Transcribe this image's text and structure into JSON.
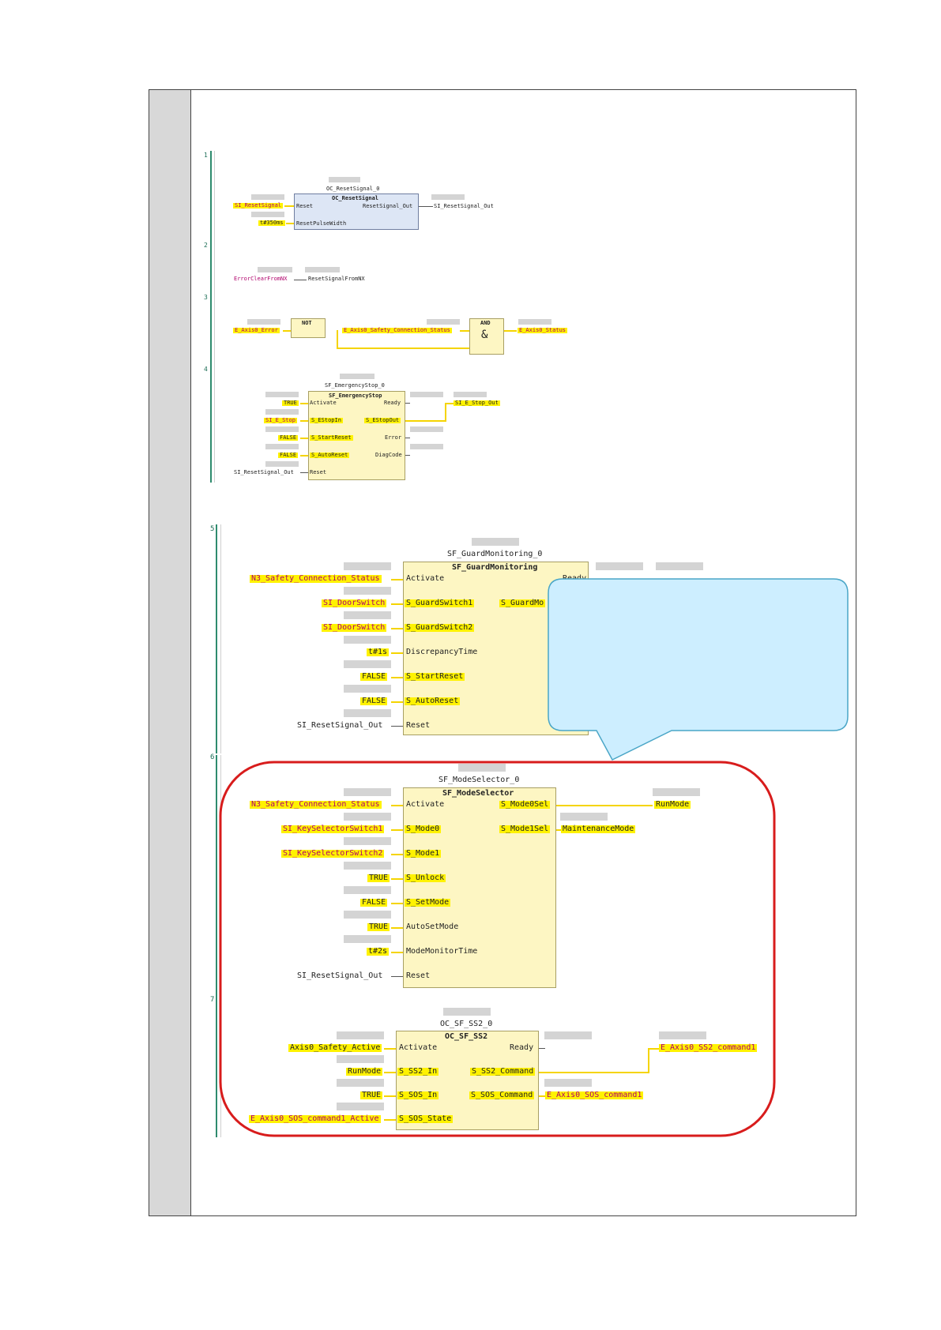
{
  "rung_numbers": [
    "1",
    "2",
    "3",
    "4",
    "5",
    "6",
    "7"
  ],
  "rung1": {
    "instance": "OC_ResetSignal_0",
    "type": "OC_ResetSignal",
    "in_reset_var": "SI_ResetSignal",
    "in_reset_pin": "Reset",
    "in_width_var": "t#350ms",
    "in_width_pin": "ResetPulseWidth",
    "out_pin": "ResetSignal_Out",
    "out_var": "SI_ResetSignal_Out"
  },
  "rung2": {
    "src": "ErrorClearFromNX",
    "dst": "ResetSignalFromNX"
  },
  "rung3": {
    "in_var": "E_Axis0_Error",
    "not_label": "NOT",
    "mid_var": "E_Axis0_Safety_Connection_Status",
    "and_label": "AND",
    "and_symbol": "&",
    "out_var": "E_Axis0_Status"
  },
  "rung4": {
    "instance": "SF_EmergencyStop_0",
    "type": "SF_EmergencyStop",
    "inputs": [
      {
        "var": "TRUE",
        "pin": "Activate"
      },
      {
        "var": "SI_E_Stop",
        "pin": "S_EStopIn"
      },
      {
        "var": "FALSE",
        "pin": "S_StartReset"
      },
      {
        "var": "FALSE",
        "pin": "S_AutoReset"
      },
      {
        "var": "SI_ResetSignal_Out",
        "pin": "Reset"
      }
    ],
    "outputs": [
      {
        "pin": "Ready",
        "var": ""
      },
      {
        "pin": "S_EStopOut",
        "var": "SI_E_Stop_Out"
      },
      {
        "pin": "Error",
        "var": ""
      },
      {
        "pin": "DiagCode",
        "var": ""
      }
    ]
  },
  "rung5": {
    "instance": "SF_GuardMonitoring_0",
    "type": "SF_GuardMonitoring",
    "inputs": [
      {
        "var": "N3_Safety_Connection_Status",
        "pin": "Activate"
      },
      {
        "var": "SI_DoorSwitch",
        "pin": "S_GuardSwitch1"
      },
      {
        "var": "SI_DoorSwitch",
        "pin": "S_GuardSwitch2"
      },
      {
        "var": "t#1s",
        "pin": "DiscrepancyTime"
      },
      {
        "var": "FALSE",
        "pin": "S_StartReset"
      },
      {
        "var": "FALSE",
        "pin": "S_AutoReset"
      },
      {
        "var": "SI_ResetSignal_Out",
        "pin": "Reset"
      }
    ],
    "partial_output_pin": "S_GuardMo",
    "partial_ready_pin": "Ready"
  },
  "rung6": {
    "instance": "SF_ModeSelector_0",
    "type": "SF_ModeSelector",
    "inputs": [
      {
        "var": "N3_Safety_Connection_Status",
        "pin": "Activate"
      },
      {
        "var": "SI_KeySelectorSwitch1",
        "pin": "S_Mode0"
      },
      {
        "var": "SI_KeySelectorSwitch2",
        "pin": "S_Mode1"
      },
      {
        "var": "TRUE",
        "pin": "S_Unlock"
      },
      {
        "var": "FALSE",
        "pin": "S_SetMode"
      },
      {
        "var": "TRUE",
        "pin": "AutoSetMode"
      },
      {
        "var": "t#2s",
        "pin": "ModeMonitorTime"
      },
      {
        "var": "SI_ResetSignal_Out",
        "pin": "Reset"
      }
    ],
    "outputs": [
      {
        "pin": "S_Mode0Sel",
        "var": "RunMode"
      },
      {
        "pin": "S_Mode1Sel",
        "var": "MaintenanceMode"
      }
    ]
  },
  "rung7": {
    "instance": "OC_SF_SS2_0",
    "type": "OC_SF_SS2",
    "inputs": [
      {
        "var": "Axis0_Safety_Active",
        "pin": "Activate"
      },
      {
        "var": "RunMode",
        "pin": "S_SS2_In"
      },
      {
        "var": "TRUE",
        "pin": "S_SOS_In"
      },
      {
        "var": "E_Axis0_SOS_command1_Active",
        "pin": "S_SOS_State"
      }
    ],
    "outputs": [
      {
        "pin": "Ready",
        "var": ""
      },
      {
        "pin": "S_SS2_Command",
        "var": "E_Axis0_SS2_command1"
      },
      {
        "pin": "S_SOS_Command",
        "var": "E_Axis0_SOS_command1"
      }
    ]
  },
  "colors": {
    "highlight": "#fff200",
    "block_fill": "#fdf6c3",
    "block_blue": "#dde6f5",
    "rail": "#2e8b6e",
    "callout_fill": "#cdeeff",
    "callout_border": "#4aa6c7",
    "red_outline": "#d81c1c"
  }
}
